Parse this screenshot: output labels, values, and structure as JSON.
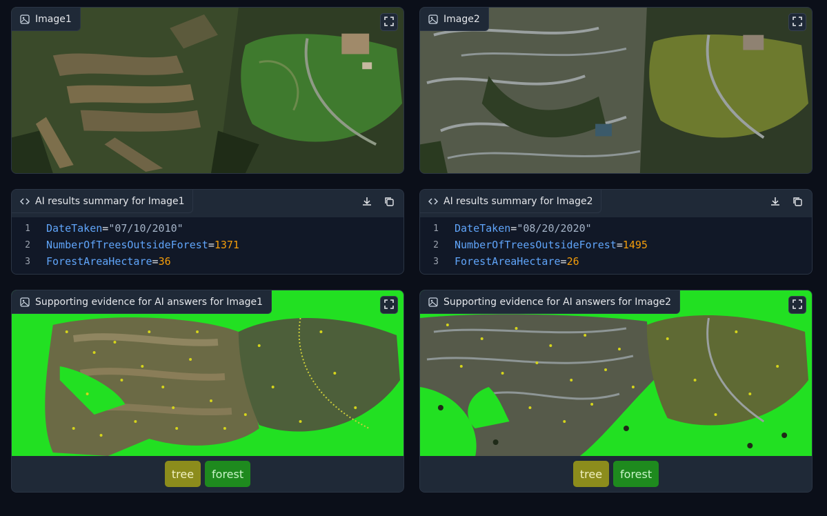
{
  "panels": {
    "image1": {
      "label": "Image1"
    },
    "image2": {
      "label": "Image2"
    },
    "summary1": {
      "label": "AI results summary for Image1",
      "lines": [
        {
          "num": "1",
          "key": "DateTaken",
          "value": "\"07/10/2010\"",
          "kind": "str"
        },
        {
          "num": "2",
          "key": "NumberOfTreesOutsideForest",
          "value": "1371",
          "kind": "num"
        },
        {
          "num": "3",
          "key": "ForestAreaHectare",
          "value": "36",
          "kind": "num"
        }
      ]
    },
    "summary2": {
      "label": "AI results summary for Image2",
      "lines": [
        {
          "num": "1",
          "key": "DateTaken",
          "value": "\"08/20/2020\"",
          "kind": "str"
        },
        {
          "num": "2",
          "key": "NumberOfTreesOutsideForest",
          "value": "1495",
          "kind": "num"
        },
        {
          "num": "3",
          "key": "ForestAreaHectare",
          "value": "26",
          "kind": "num"
        }
      ]
    },
    "evidence1": {
      "label": "Supporting evidence for AI answers for Image1"
    },
    "evidence2": {
      "label": "Supporting evidence for AI answers for Image2"
    }
  },
  "legend": {
    "tree": "tree",
    "forest": "forest"
  },
  "colors": {
    "background": "#0b0f19",
    "panel": "#1f2937",
    "forest_mask": "#22e022",
    "tree_marker": "#d4d41c",
    "key_blue": "#60a5fa",
    "number_orange": "#f59e0b"
  },
  "icons": {
    "image_tag": "image-icon",
    "code_tag": "code-icon",
    "expand": "fullscreen-icon",
    "download": "download-icon",
    "copy": "copy-icon"
  }
}
